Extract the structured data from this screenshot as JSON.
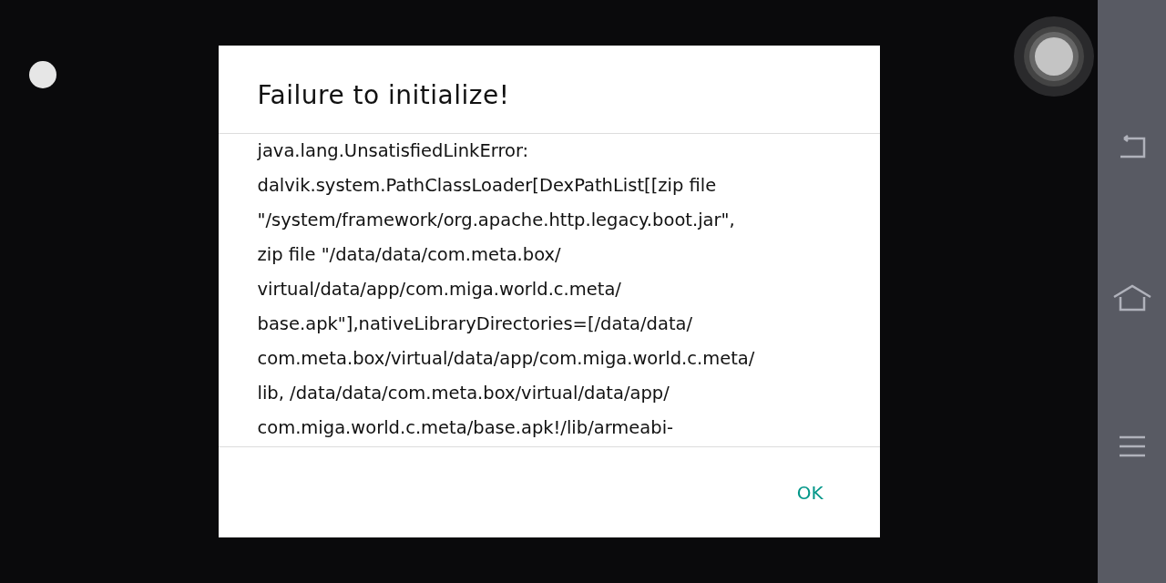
{
  "dialog": {
    "title": "Failure to initialize!",
    "message_lines": [
      "java.lang.UnsatisfiedLinkError:",
      "dalvik.system.PathClassLoader[DexPathList[[zip file",
      "\"/system/framework/org.apache.http.legacy.boot.jar\",",
      "zip file \"/data/data/com.meta.box/",
      "virtual/data/app/com.miga.world.c.meta/",
      "base.apk\"],nativeLibraryDirectories=[/data/data/",
      "com.meta.box/virtual/data/app/com.miga.world.c.meta/",
      "lib, /data/data/com.meta.box/virtual/data/app/",
      "com.miga.world.c.meta/base.apk!/lib/armeabi-"
    ],
    "buttons": [
      "OK"
    ]
  }
}
